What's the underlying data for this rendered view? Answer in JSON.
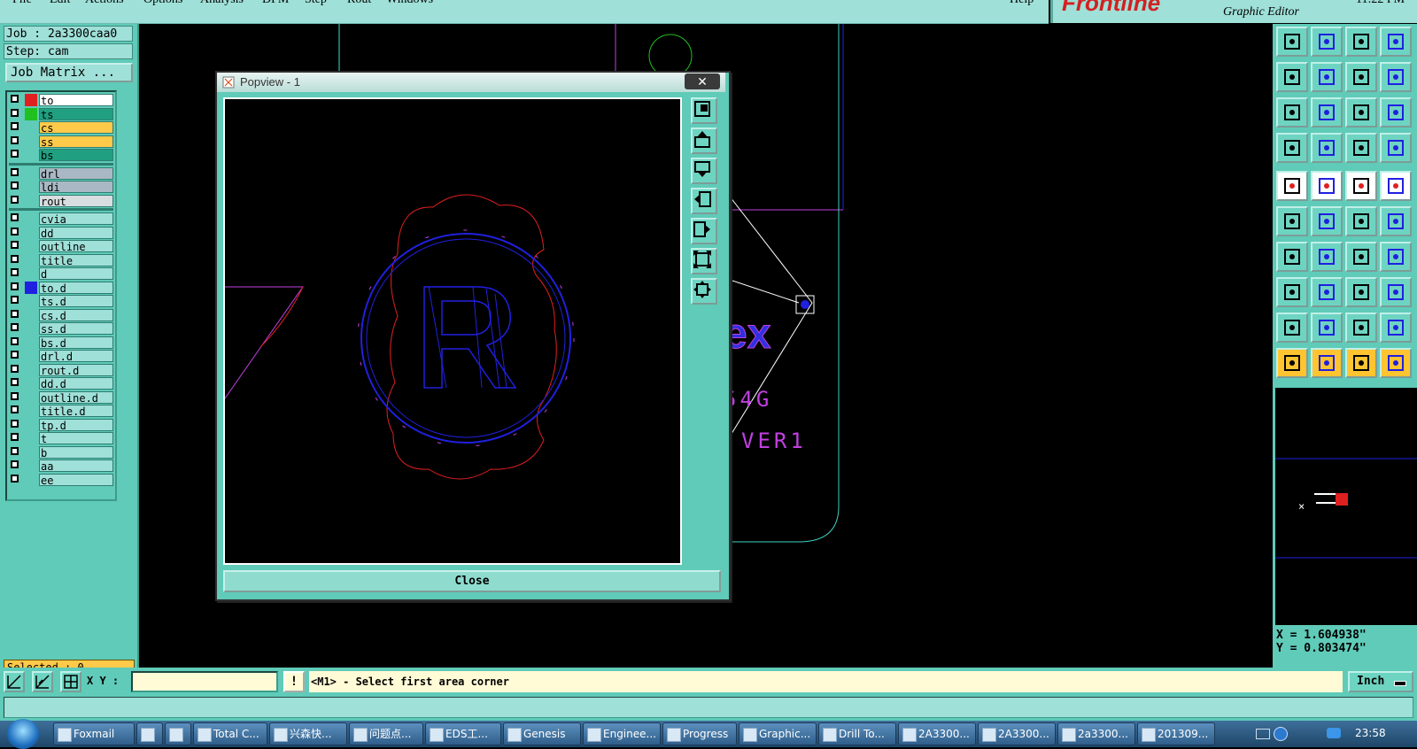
{
  "menubar": {
    "items": [
      "File",
      "Edit",
      "Actions",
      "Options",
      "Analysis",
      "DFM",
      "Step",
      "Rout",
      "Windows"
    ],
    "help": "Help"
  },
  "brand": {
    "logo": "Frontline",
    "subtitle": "Graphic Editor",
    "clock": "11:22 PM"
  },
  "job": {
    "job_label": "Job : 2a3300caa0",
    "step_label": "Step: cam",
    "matrix_button": "Job Matrix ..."
  },
  "layers": [
    {
      "name": "to",
      "swatch": "#e02020",
      "bg": "#ffffff",
      "group": 1
    },
    {
      "name": "ts",
      "swatch": "#20c020",
      "bg": "#20a080",
      "group": 1
    },
    {
      "name": "cs",
      "swatch": "",
      "bg": "#ffc94a",
      "group": 1
    },
    {
      "name": "ss",
      "swatch": "",
      "bg": "#ffc94a",
      "group": 1
    },
    {
      "name": "bs",
      "swatch": "",
      "bg": "#20a080",
      "group": 1
    },
    {
      "name": "drl",
      "swatch": "",
      "bg": "#a9b8c4",
      "group": 2
    },
    {
      "name": "ldi",
      "swatch": "",
      "bg": "#a9b8c4",
      "group": 2
    },
    {
      "name": "rout",
      "swatch": "",
      "bg": "#d8dde0",
      "group": 2
    },
    {
      "name": "cvia",
      "swatch": "",
      "bg": "#9fe0d8",
      "group": 3
    },
    {
      "name": "dd",
      "swatch": "",
      "bg": "#9fe0d8",
      "group": 3
    },
    {
      "name": "outline",
      "swatch": "",
      "bg": "#9fe0d8",
      "group": 3
    },
    {
      "name": "title",
      "swatch": "",
      "bg": "#9fe0d8",
      "group": 3
    },
    {
      "name": "d",
      "swatch": "",
      "bg": "#9fe0d8",
      "group": 3
    },
    {
      "name": "to.d",
      "swatch": "#2020e0",
      "bg": "#9fe0d8",
      "group": 3
    },
    {
      "name": "ts.d",
      "swatch": "",
      "bg": "#9fe0d8",
      "group": 3
    },
    {
      "name": "cs.d",
      "swatch": "",
      "bg": "#9fe0d8",
      "group": 3
    },
    {
      "name": "ss.d",
      "swatch": "",
      "bg": "#9fe0d8",
      "group": 3
    },
    {
      "name": "bs.d",
      "swatch": "",
      "bg": "#9fe0d8",
      "group": 3
    },
    {
      "name": "drl.d",
      "swatch": "",
      "bg": "#9fe0d8",
      "group": 3
    },
    {
      "name": "rout.d",
      "swatch": "",
      "bg": "#9fe0d8",
      "group": 3
    },
    {
      "name": "dd.d",
      "swatch": "",
      "bg": "#9fe0d8",
      "group": 3
    },
    {
      "name": "outline.d",
      "swatch": "",
      "bg": "#9fe0d8",
      "group": 3
    },
    {
      "name": "title.d",
      "swatch": "",
      "bg": "#9fe0d8",
      "group": 3
    },
    {
      "name": "tp.d",
      "swatch": "",
      "bg": "#9fe0d8",
      "group": 3
    },
    {
      "name": "t",
      "swatch": "",
      "bg": "#9fe0d8",
      "group": 3
    },
    {
      "name": "b",
      "swatch": "",
      "bg": "#9fe0d8",
      "group": 3
    },
    {
      "name": "aa",
      "swatch": "",
      "bg": "#9fe0d8",
      "group": 3
    },
    {
      "name": "ee",
      "swatch": "",
      "bg": "#9fe0d8",
      "group": 3
    }
  ],
  "selected_label": "Selected : 0",
  "popview": {
    "title": "Popview - 1",
    "close_button": "Close",
    "close_x": "✕"
  },
  "canvas": {
    "text_partial": "ex",
    "text_line2": "54G",
    "text_line3": "VER1"
  },
  "coords": {
    "x": "X = 1.604938\"",
    "y": "Y = 0.803474\""
  },
  "command": {
    "xy_label": "X Y :",
    "xy_value": "",
    "excl": "!",
    "prompt": "<M1> - Select first area corner",
    "unit": "Inch"
  },
  "taskbar": {
    "tasks": [
      "Foxmail",
      "",
      "",
      "Total C...",
      "兴森快...",
      "问题点...",
      "EDS工...",
      "Genesis",
      "Enginee...",
      "Progress",
      "Graphic...",
      "Drill To...",
      "2A3300...",
      "2A3300...",
      "2a3300...",
      "201309..."
    ],
    "time": "23:58"
  },
  "colors": {
    "panel": "#5fcbb8",
    "accent_red": "#e02020",
    "accent_blue": "#2020e0"
  }
}
